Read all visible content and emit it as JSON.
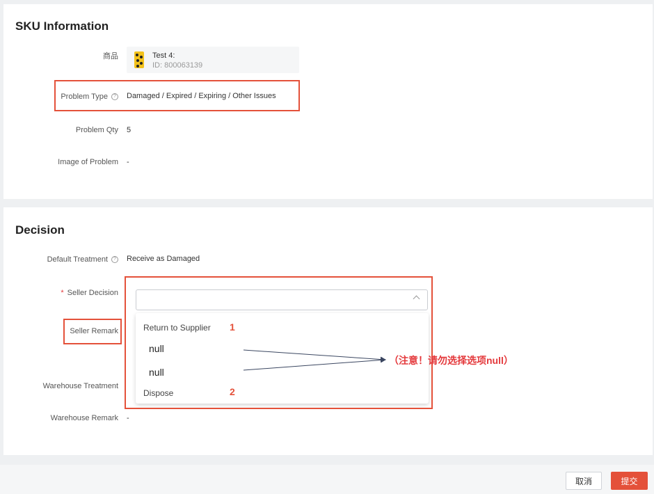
{
  "sku_section": {
    "title": "SKU Information",
    "product_label": "商品",
    "product_name": "Test 4:",
    "product_id": "ID: 800063139",
    "problem_type_label": "Problem Type",
    "problem_type_value": "Damaged / Expired / Expiring / Other Issues",
    "problem_qty_label": "Problem Qty",
    "problem_qty_value": "5",
    "image_label": "Image of Problem",
    "image_value": "-"
  },
  "decision_section": {
    "title": "Decision",
    "default_treatment_label": "Default Treatment",
    "default_treatment_value": "Receive as Damaged",
    "seller_decision_label": "Seller Decision",
    "required_mark": "*",
    "seller_remark_label": "Seller Remark",
    "warehouse_treatment_label": "Warehouse Treatment",
    "warehouse_remark_label": "Warehouse Remark",
    "warehouse_remark_value": "-"
  },
  "dropdown": {
    "options": [
      "Return to Supplier",
      "null",
      "null",
      "Dispose"
    ]
  },
  "annotations": {
    "num1": "1",
    "num2": "2",
    "warning": "（注意！请勿选择选项null）",
    "color": "#e4513a"
  },
  "footer": {
    "cancel_label": "取消",
    "submit_label": "提交"
  },
  "colors": {
    "accent": "#e4513a",
    "background": "#eef0f2"
  },
  "icons": [
    "help-icon",
    "chevron-up-icon",
    "product-thumbnail"
  ]
}
